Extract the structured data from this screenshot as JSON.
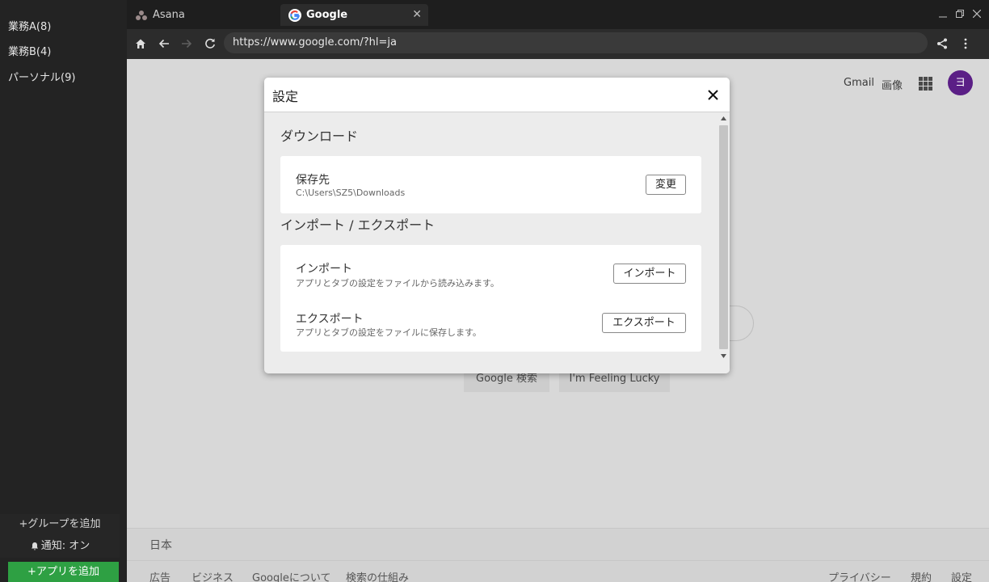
{
  "sidebar": {
    "groups": [
      {
        "label": "業務A(8)"
      },
      {
        "label": "業務B(4)"
      },
      {
        "label": "パーソナル(9)"
      }
    ],
    "add_group_label": "+グループを追加",
    "notification_label": "通知: オン",
    "add_app_label": "+アプリを追加"
  },
  "browser": {
    "tabs": [
      {
        "title": "Asana",
        "icon": "asana-icon"
      },
      {
        "title": "Google",
        "icon": "google-icon"
      }
    ],
    "url": "https://www.google.com/?hl=ja"
  },
  "google_page": {
    "links": {
      "gmail": "Gmail",
      "images": "画像"
    },
    "avatar_letter": "ヨ",
    "search_button": "Google 検索",
    "lucky_button": "I'm Feeling Lucky",
    "country": "日本",
    "footer_left": [
      "広告",
      "ビジネス",
      "Googleについて",
      "検索の仕組み"
    ],
    "footer_right": [
      "プライバシー",
      "規約",
      "設定"
    ]
  },
  "settings_dialog": {
    "title": "設定",
    "download": {
      "section_title": "ダウンロード",
      "save_location_label": "保存先",
      "save_location_path": "C:\\Users\\SZ5\\Downloads",
      "change_button": "変更"
    },
    "import_export": {
      "section_title": "インポート / エクスポート",
      "import_label": "インポート",
      "import_desc": "アプリとタブの設定をファイルから読み込みます。",
      "import_button": "インポート",
      "export_label": "エクスポート",
      "export_desc": "アプリとタブの設定をファイルに保存します。",
      "export_button": "エクスポート"
    }
  },
  "colors": {
    "add_app_green": "#2ea043",
    "avatar_purple": "#5b1f86",
    "sidebar_bg": "#232323"
  }
}
